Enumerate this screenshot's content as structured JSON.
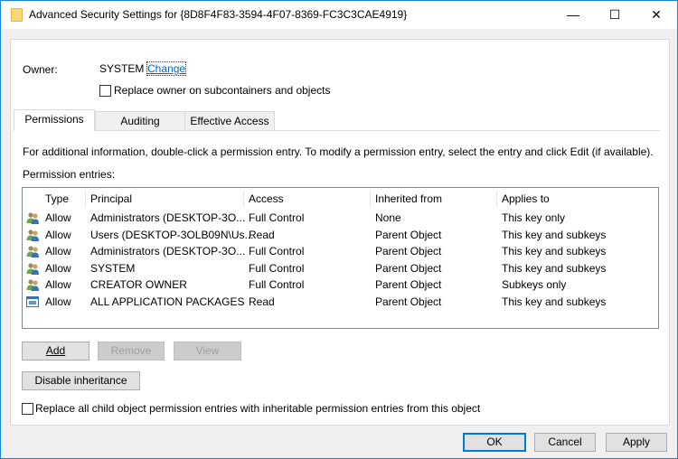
{
  "window": {
    "title": "Advanced Security Settings for {8D8F4F83-3594-4F07-8369-FC3C3CAE4919}",
    "minimize": "—",
    "maximize": "☐",
    "close": "✕"
  },
  "owner": {
    "label": "Owner:",
    "value": "SYSTEM",
    "change_link": "Change",
    "replace_checkbox": "Replace owner on subcontainers and objects",
    "replace_checked": false
  },
  "tabs": [
    {
      "label": "Permissions",
      "active": true
    },
    {
      "label": "Auditing"
    },
    {
      "label": "Effective Access"
    }
  ],
  "info": "For additional information, double-click a permission entry. To modify a permission entry, select the entry and click Edit (if available).",
  "entries_label": "Permission entries:",
  "columns": [
    "Type",
    "Principal",
    "Access",
    "Inherited from",
    "Applies to"
  ],
  "rows": [
    {
      "icon": "users-icon",
      "type": "Allow",
      "principal": "Administrators (DESKTOP-3O...",
      "access": "Full Control",
      "inherited": "None",
      "applies": "This key only"
    },
    {
      "icon": "users-icon",
      "type": "Allow",
      "principal": "Users (DESKTOP-3OLB09N\\Us...",
      "access": "Read",
      "inherited": "Parent Object",
      "applies": "This key and subkeys"
    },
    {
      "icon": "users-icon",
      "type": "Allow",
      "principal": "Administrators (DESKTOP-3O...",
      "access": "Full Control",
      "inherited": "Parent Object",
      "applies": "This key and subkeys"
    },
    {
      "icon": "users-icon",
      "type": "Allow",
      "principal": "SYSTEM",
      "access": "Full Control",
      "inherited": "Parent Object",
      "applies": "This key and subkeys"
    },
    {
      "icon": "users-icon",
      "type": "Allow",
      "principal": "CREATOR OWNER",
      "access": "Full Control",
      "inherited": "Parent Object",
      "applies": "Subkeys only"
    },
    {
      "icon": "app-packages-icon",
      "type": "Allow",
      "principal": "ALL APPLICATION PACKAGES",
      "access": "Read",
      "inherited": "Parent Object",
      "applies": "This key and subkeys"
    }
  ],
  "buttons": {
    "add": "Add",
    "remove": "Remove",
    "view": "View",
    "disable_inheritance": "Disable inheritance",
    "ok": "OK",
    "cancel": "Cancel",
    "apply": "Apply"
  },
  "replace_child_checkbox": "Replace all child object permission entries with inheritable permission entries from this object",
  "replace_child_checked": false
}
